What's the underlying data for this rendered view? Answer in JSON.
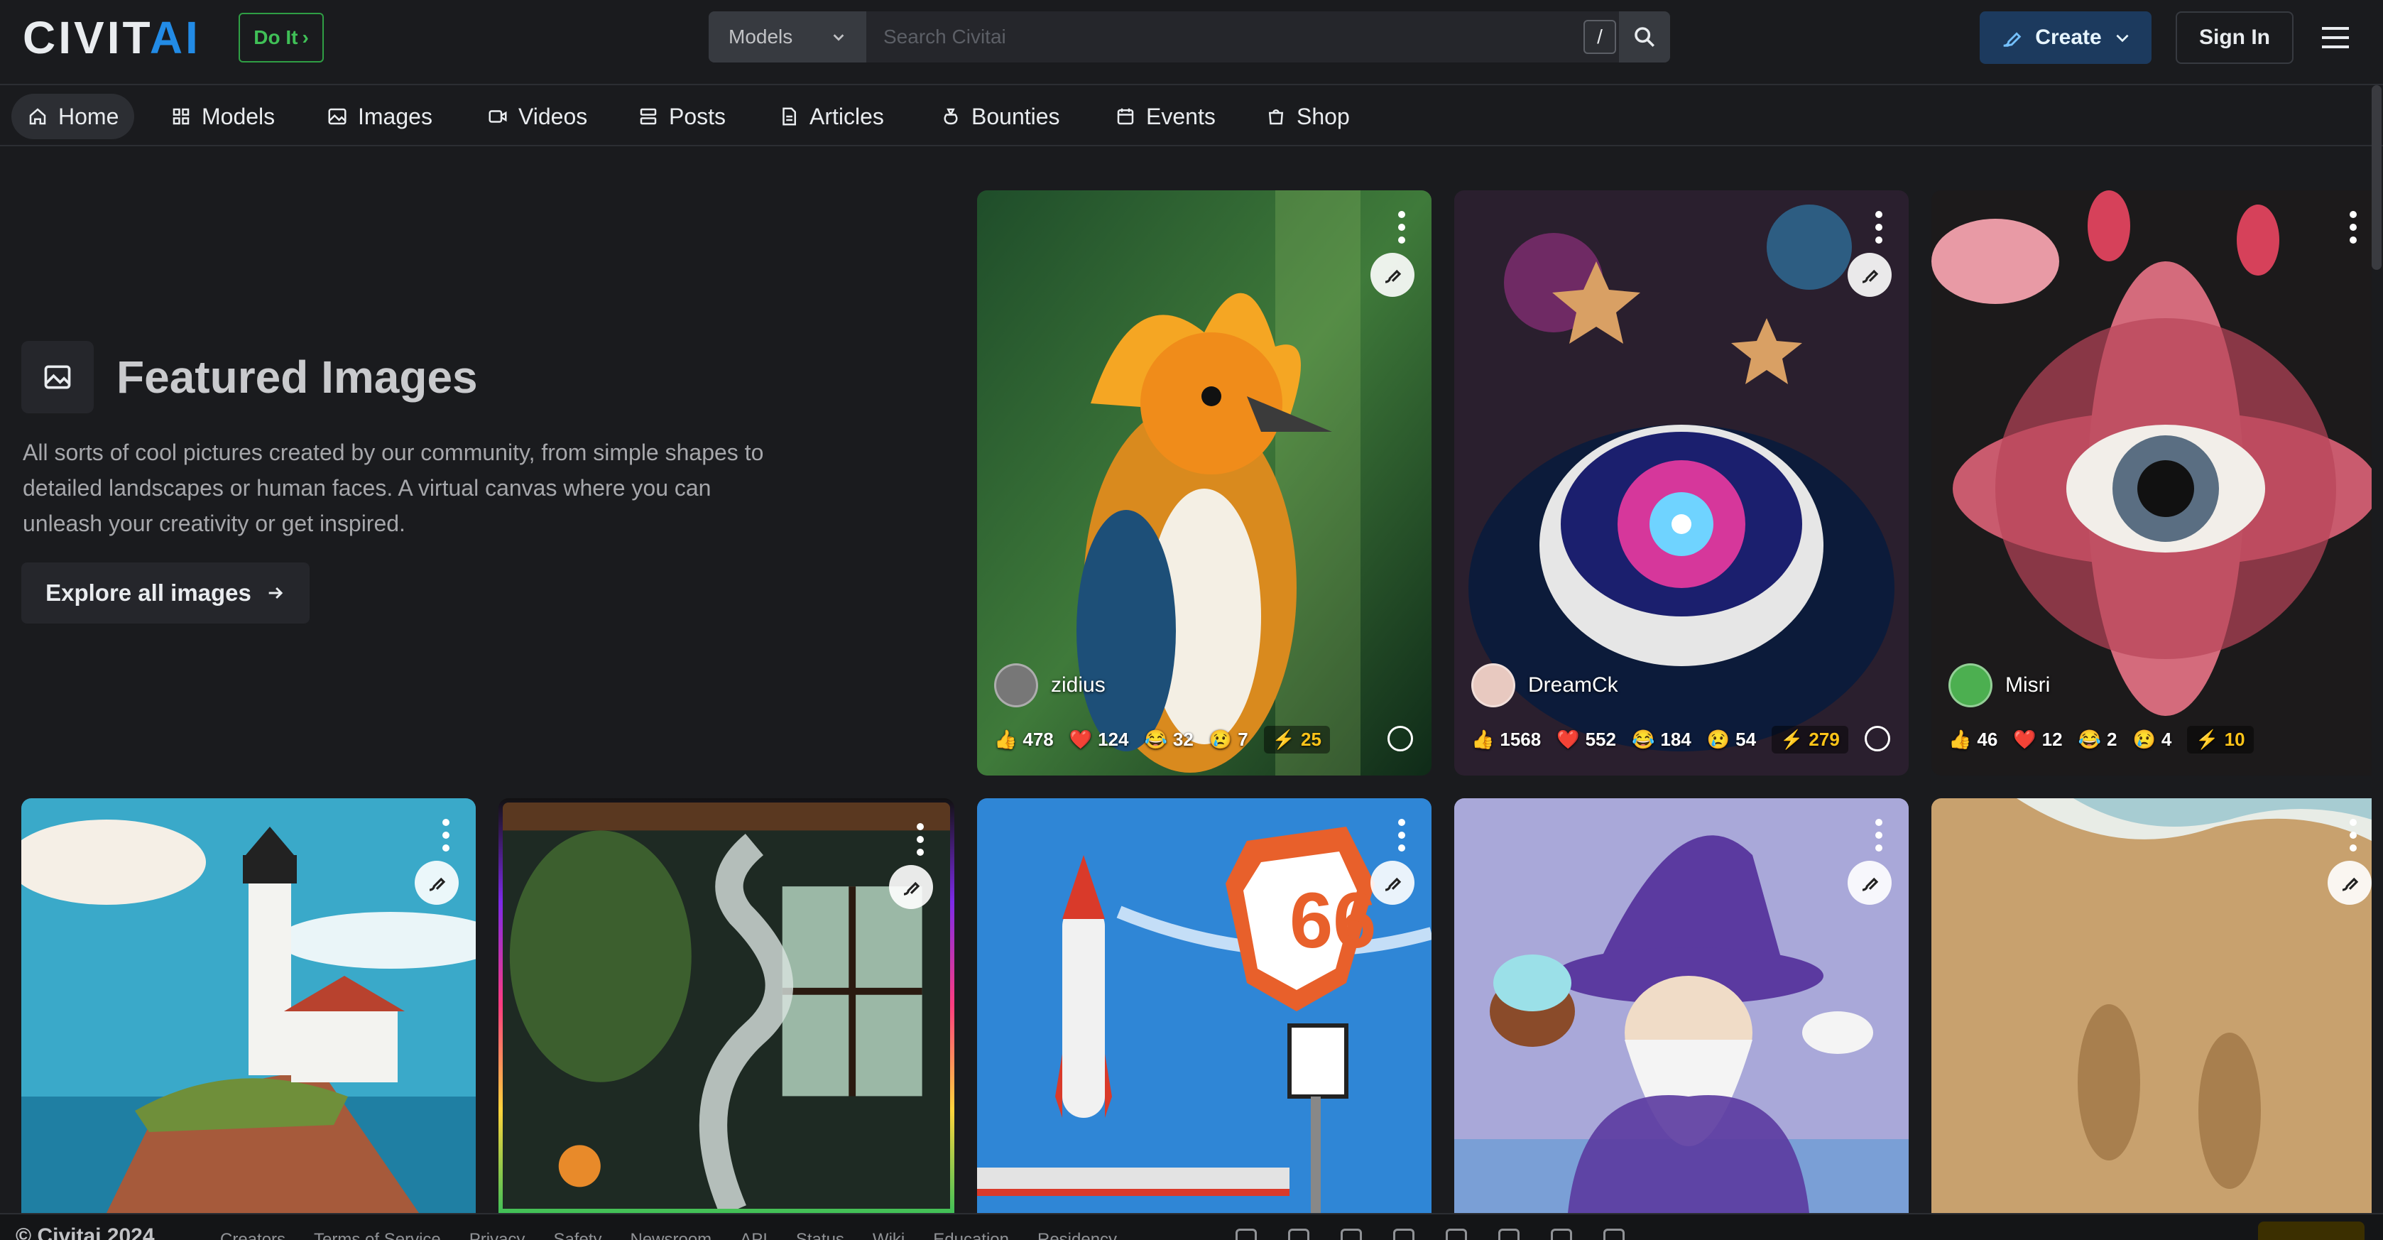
{
  "header": {
    "logo_text": "CIVIT",
    "logo_accent": "AI",
    "doit_label": "Do It",
    "search_scope": "Models",
    "search_placeholder": "Search Civitai",
    "search_shortcut": "/",
    "create_label": "Create",
    "signin_label": "Sign In"
  },
  "nav": {
    "items": [
      {
        "label": "Home",
        "icon": "home-icon"
      },
      {
        "label": "Models",
        "icon": "grid-icon"
      },
      {
        "label": "Images",
        "icon": "image-icon"
      },
      {
        "label": "Videos",
        "icon": "video-icon"
      },
      {
        "label": "Posts",
        "icon": "posts-icon"
      },
      {
        "label": "Articles",
        "icon": "article-icon"
      },
      {
        "label": "Bounties",
        "icon": "moneybag-icon"
      },
      {
        "label": "Events",
        "icon": "calendar-icon"
      },
      {
        "label": "Shop",
        "icon": "shopping-bag-icon"
      }
    ]
  },
  "hero": {
    "title": "Featured Images",
    "description": "All sorts of cool pictures created by our community, from simple shapes to detailed landscapes or human faces. A virtual canvas where you can unleash your creativity or get inspired.",
    "cta": "Explore all images"
  },
  "cards": [
    {
      "subject": "orange crested bird in jungle",
      "user": "zidius",
      "likes": "478",
      "hearts": "124",
      "laughs": "32",
      "cries": "7",
      "buzz": "25"
    },
    {
      "subject": "galaxy in coffee cup with star cookies",
      "user": "DreamCk",
      "likes": "1568",
      "hearts": "552",
      "laughs": "184",
      "cries": "54",
      "buzz": "279"
    },
    {
      "subject": "pink flower with eye",
      "user": "Misri",
      "likes": "46",
      "hearts": "12",
      "laughs": "2",
      "cries": "4",
      "buzz": "10"
    },
    {
      "subject": "lighthouse on cliff"
    },
    {
      "subject": "smoke by window with plants"
    },
    {
      "subject": "rocket and Route 66 sign"
    },
    {
      "subject": "wizard figurine with cupcakes"
    },
    {
      "subject": "footprints in sand"
    }
  ],
  "footer": {
    "copyright": "© Civitai 2024",
    "links": [
      "Creators",
      "Terms of Service",
      "Privacy",
      "Safety",
      "Newsroom",
      "API",
      "Status",
      "Wiki",
      "Education",
      "Residency"
    ],
    "socials": [
      "discord-icon",
      "x-icon",
      "instagram-icon",
      "youtube-icon",
      "tiktok-icon",
      "reddit-icon",
      "github-icon",
      "twitch-icon"
    ]
  },
  "colors": {
    "accent": "#228be6",
    "doit": "#40c057",
    "create_bg": "#1c3a5e",
    "buzz": "#fcc419"
  }
}
